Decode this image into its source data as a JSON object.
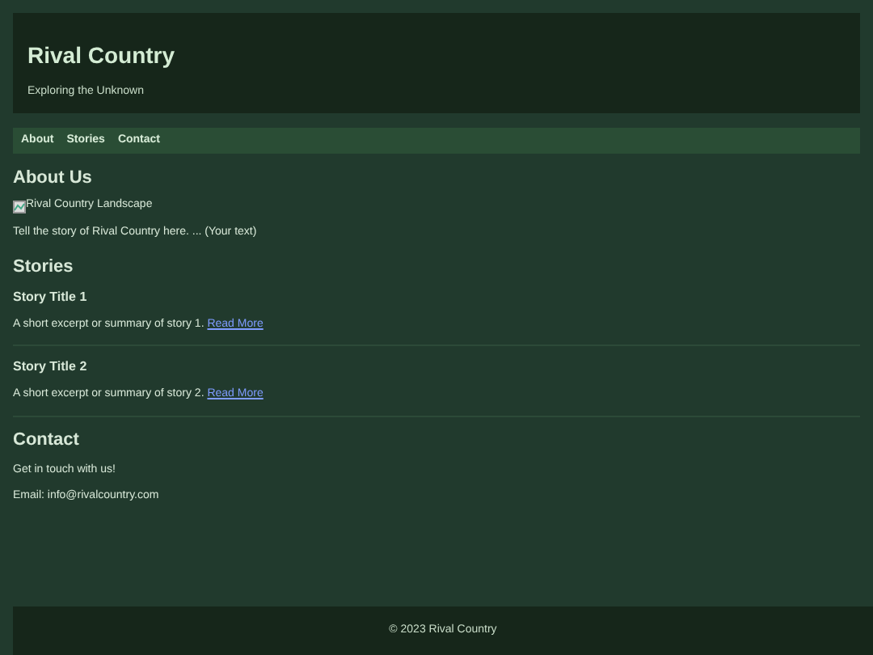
{
  "header": {
    "title": "Rival Country",
    "tagline": "Exploring the Unknown"
  },
  "nav": [
    {
      "label": "About"
    },
    {
      "label": "Stories"
    },
    {
      "label": "Contact"
    }
  ],
  "about": {
    "heading": "About Us",
    "image_alt": "Rival Country Landscape",
    "text": "Tell the story of Rival Country here. ... (Your text)"
  },
  "stories": {
    "heading": "Stories",
    "items": [
      {
        "title": "Story Title 1",
        "excerpt": "A short excerpt or summary of story 1.",
        "link": "Read More"
      },
      {
        "title": "Story Title 2",
        "excerpt": "A short excerpt or summary of story 2.",
        "link": "Read More"
      }
    ]
  },
  "contact": {
    "heading": "Contact",
    "text": "Get in touch with us!",
    "email": "Email: info@rivalcountry.com"
  },
  "footer": {
    "text": "© 2023 Rival Country"
  }
}
